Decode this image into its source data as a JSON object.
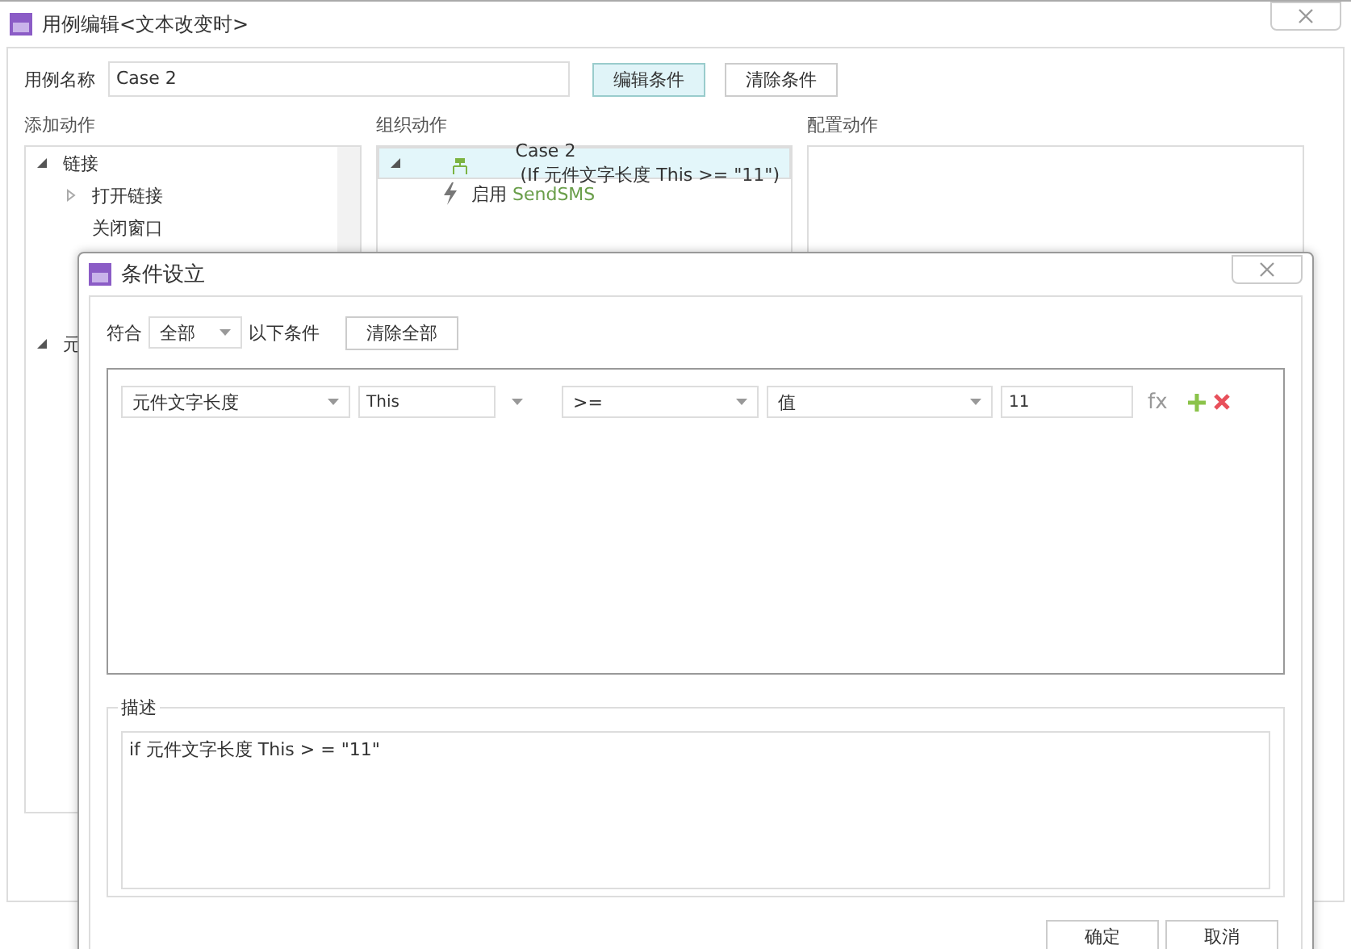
{
  "window": {
    "title": "用例编辑<文本改变时>"
  },
  "case_name": {
    "label": "用例名称",
    "value": "Case 2"
  },
  "buttons": [
    {
      "label": "编辑条件",
      "selected": true
    },
    {
      "label": "清除条件",
      "selected": false
    }
  ],
  "add_actions": {
    "heading": "添加动作",
    "tree": [
      {
        "label": "链接",
        "expanded": true,
        "children": [
          {
            "label": "打开链接",
            "expanded": false
          },
          {
            "label": "关闭窗口"
          }
        ]
      },
      {
        "label": "元",
        "expanded": true
      }
    ]
  },
  "organize_actions": {
    "heading": "组织动作",
    "case": {
      "name": "Case 2",
      "condition": "(If 元件文字长度 This >= \"11\")",
      "expanded": true,
      "selected": true,
      "actions": [
        {
          "verb": "启用",
          "target": "SendSMS"
        }
      ]
    }
  },
  "configure_actions": {
    "heading": "配置动作"
  },
  "dialog": {
    "title": "条件设立",
    "match": {
      "label_before": "符合",
      "value": "全部",
      "label_after": "以下条件"
    },
    "clear_all": "清除全部",
    "conditions": [
      {
        "fields": [
          {
            "kind": "select",
            "value": "元件文字长度"
          },
          {
            "kind": "select-outside",
            "value": "This"
          },
          {
            "kind": "select",
            "value": ">="
          },
          {
            "kind": "select",
            "value": "值"
          },
          {
            "kind": "input",
            "value": "11"
          }
        ],
        "fx": "fx"
      }
    ],
    "description": {
      "legend": "描述",
      "text": "if 元件文字长度 This > = \"11\""
    },
    "buttons": [
      "确定",
      "取消"
    ]
  }
}
